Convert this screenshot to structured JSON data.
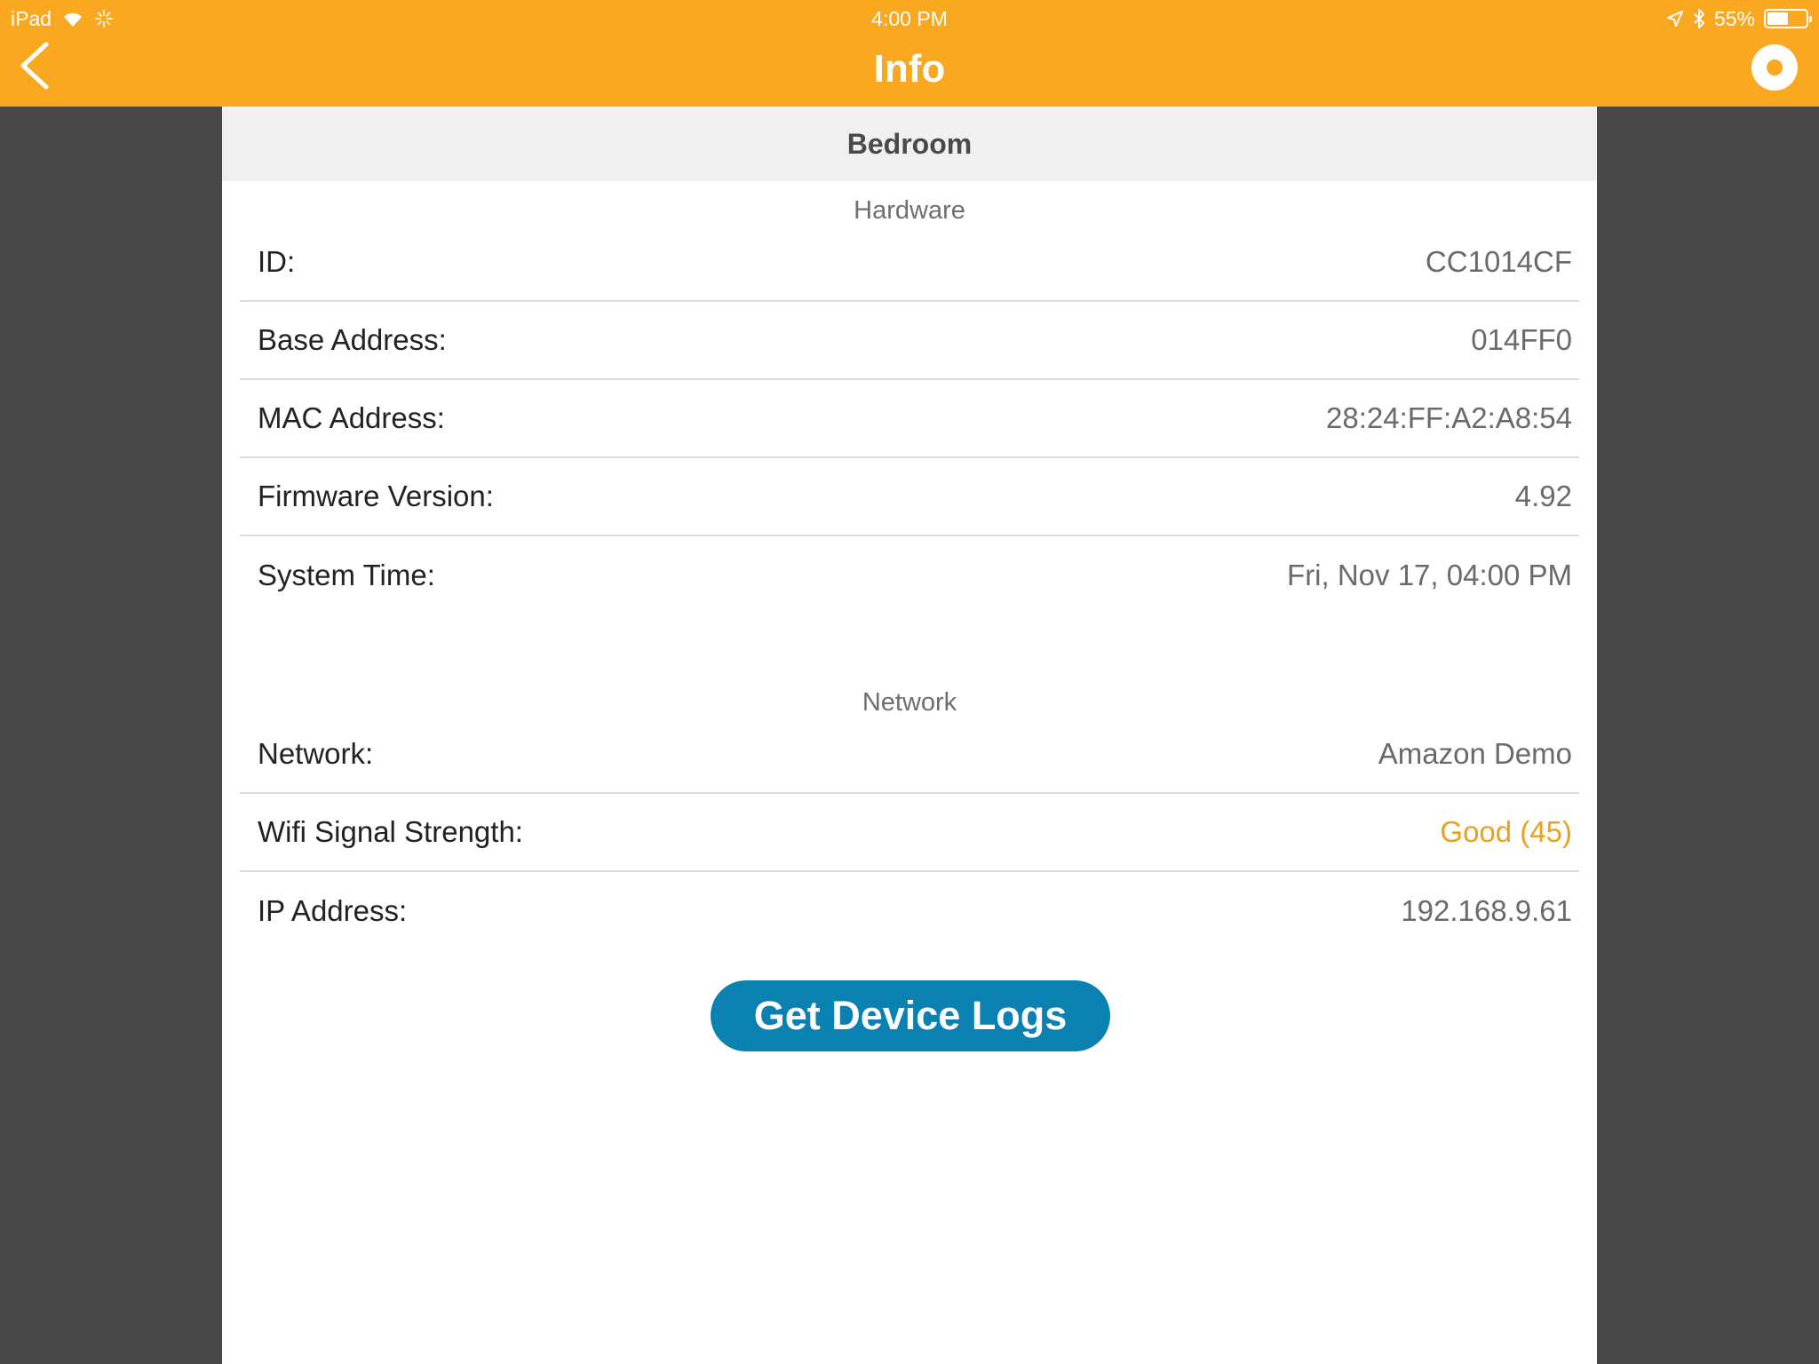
{
  "status_bar": {
    "device": "iPad",
    "time": "4:00 PM",
    "battery_percent": "55%",
    "battery_level": 0.55
  },
  "nav": {
    "title": "Info"
  },
  "device": {
    "name": "Bedroom"
  },
  "hardware": {
    "section_title": "Hardware",
    "rows": [
      {
        "label": "ID:",
        "value": "CC1014CF"
      },
      {
        "label": "Base Address:",
        "value": "014FF0"
      },
      {
        "label": "MAC Address:",
        "value": "28:24:FF:A2:A8:54"
      },
      {
        "label": "Firmware Version:",
        "value": "4.92"
      },
      {
        "label": "System Time:",
        "value": "Fri, Nov 17, 04:00 PM"
      }
    ]
  },
  "network": {
    "section_title": "Network",
    "rows": [
      {
        "label": "Network:",
        "value": "Amazon Demo"
      },
      {
        "label": "Wifi Signal Strength:",
        "value": "Good (45)"
      },
      {
        "label": "IP Address:",
        "value": "192.168.9.61"
      }
    ]
  },
  "actions": {
    "logs_label": "Get Device Logs"
  },
  "colors": {
    "nav_bar": "#F9A81F",
    "button": "#0A81B0",
    "signal_good": "#EBA21A"
  }
}
